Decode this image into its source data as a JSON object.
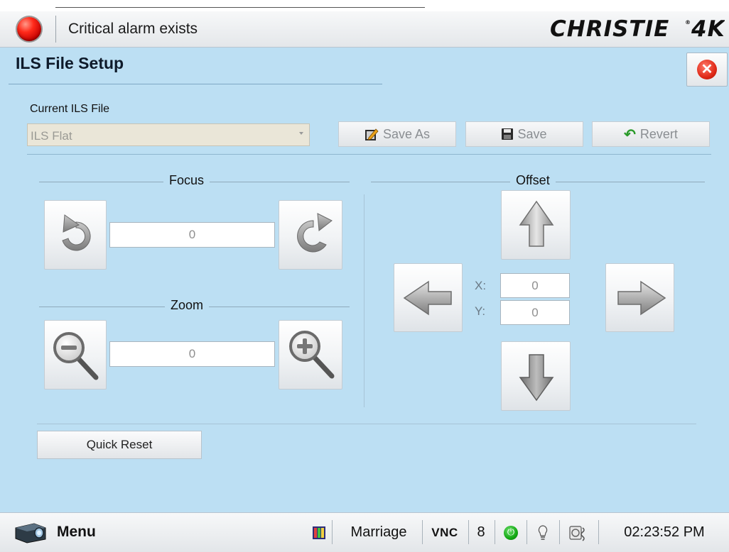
{
  "header": {
    "alarm_text": "Critical alarm exists",
    "logo": "CHRISTIE 4K",
    "alarm_icon": "red-alarm-light",
    "alarm_color": "#e0140a"
  },
  "page": {
    "title": "ILS File Setup",
    "close_icon": "close-x-icon"
  },
  "file": {
    "label": "Current ILS File",
    "selected": "ILS Flat"
  },
  "toolbar": {
    "save_as_label": "Save As",
    "save_label": "Save",
    "revert_label": "Revert"
  },
  "focus": {
    "title": "Focus",
    "value": "0"
  },
  "zoom": {
    "title": "Zoom",
    "value": "0"
  },
  "offset": {
    "title": "Offset",
    "x_label": "X:",
    "y_label": "Y:",
    "x_value": "0",
    "y_value": "0"
  },
  "quick_reset_label": "Quick Reset",
  "statusbar": {
    "menu_label": "Menu",
    "preset": "Marriage",
    "vnc": "VNC",
    "count": "8",
    "time": "02:23:52 PM",
    "power_color": "#13a913"
  }
}
